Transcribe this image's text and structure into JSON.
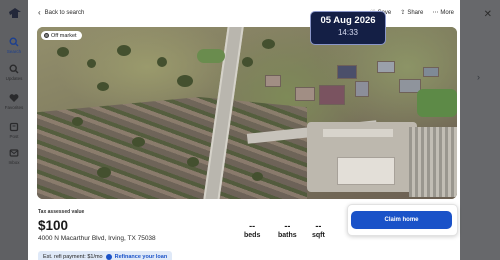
{
  "rail": {
    "items": [
      {
        "label": "Search",
        "icon": "search-icon"
      },
      {
        "label": "Updates",
        "icon": "bell-icon"
      },
      {
        "label": "Favorites",
        "icon": "heart-icon"
      },
      {
        "label": "Post",
        "icon": "post-icon"
      },
      {
        "label": "Inbox",
        "icon": "inbox-icon"
      }
    ]
  },
  "modal": {
    "back_label": "Back to search",
    "actions": {
      "save": "Save",
      "share": "Share",
      "more": "More"
    },
    "photo_badge": "Off market",
    "tax_label": "Tax assessed value",
    "price": "$100",
    "address": "4000 N Macarthur Blvd, Irving, TX 75038",
    "stats": [
      {
        "value": "--",
        "label": "beds"
      },
      {
        "value": "--",
        "label": "baths"
      },
      {
        "value": "--",
        "label": "sqft"
      }
    ],
    "claim_button": "Claim home",
    "refi": {
      "text": "Est. refi payment: $1/mo",
      "link": "Refinance your loan"
    }
  },
  "overlay": {
    "date": "05 Aug 2026",
    "time": "14:33"
  },
  "colors": {
    "primary": "#1a52c8",
    "overlay_bg": "#141f45",
    "refi_bg": "#dfe9f8"
  }
}
